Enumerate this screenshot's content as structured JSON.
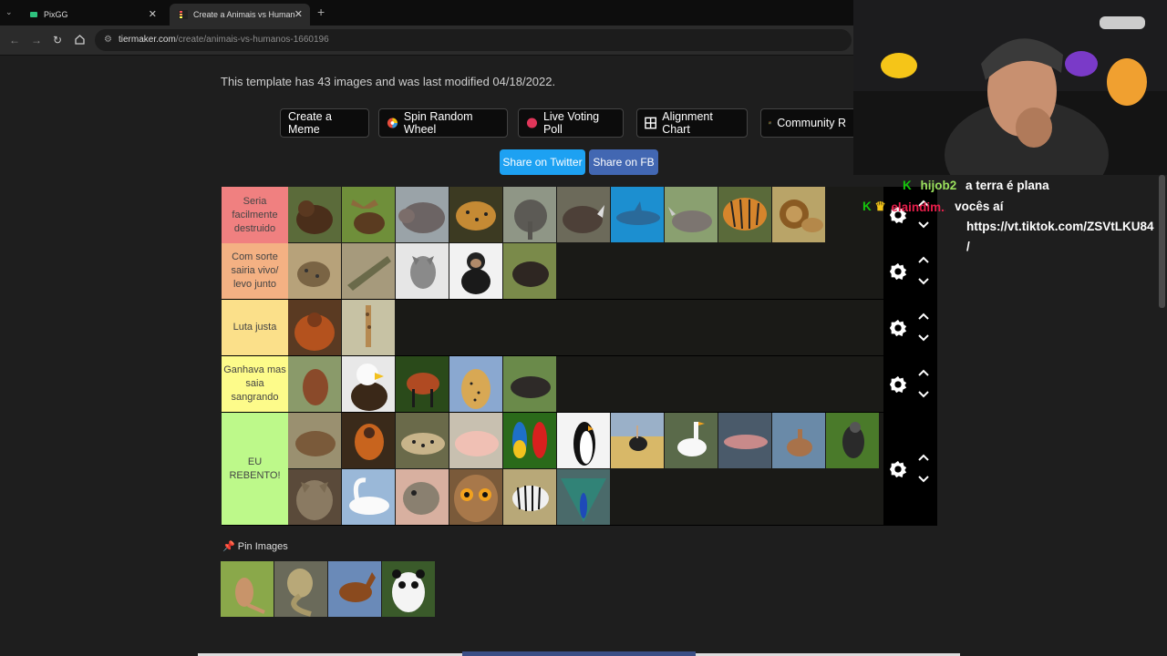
{
  "browser": {
    "tabs": [
      {
        "label": "PixGG"
      },
      {
        "label": "Create a Animais vs Humanos T"
      }
    ],
    "url_host": "tiermaker.com",
    "url_path": "/create/animais-vs-humanos-1660196"
  },
  "page": {
    "info_text": "This template has 43 images and was last modified 04/18/2022.",
    "buttons": {
      "create_meme": "Create a Meme",
      "spin_wheel": "Spin Random Wheel",
      "live_poll": "Live Voting Poll",
      "alignment": "Alignment Chart",
      "community": "Community R"
    },
    "share": {
      "twitter": "Share on Twitter",
      "fb": "Share on FB"
    },
    "tiers": [
      {
        "label": "Seria facilmente destruido",
        "color": "#f08080",
        "items": [
          "bear",
          "moose",
          "hippo",
          "jaguar",
          "elephant",
          "rhino",
          "shark",
          "rhino2",
          "tiger",
          "lion"
        ]
      },
      {
        "label": "Com sorte sairia vivo/ levo junto",
        "color": "#f4b183",
        "items": [
          "hyena",
          "crocodile",
          "wolf",
          "chimpanzee",
          "boar"
        ]
      },
      {
        "label": "Luta justa",
        "color": "#fbe08a",
        "items": [
          "orangutan",
          "giraffe"
        ]
      },
      {
        "label": "Ganhava mas saia sangrando",
        "color": "#fdfb8a",
        "items": [
          "dog",
          "eagle",
          "maned-wolf",
          "cheetah",
          "tapir"
        ]
      },
      {
        "label": "EU REBENTO!",
        "color": "#bdf98a",
        "items": [
          "capybara",
          "monkey",
          "ocelot",
          "pig",
          "macaws",
          "penguin",
          "ostrich",
          "goose",
          "dolphin",
          "deer",
          "hawk",
          "cat",
          "swan",
          "piranha",
          "owl",
          "zebra",
          "peacock"
        ]
      }
    ],
    "pin_label": "Pin Images",
    "pinned": [
      "kangaroo",
      "cobra",
      "horse",
      "panda"
    ]
  },
  "chat": {
    "messages": [
      {
        "user": "hijob2",
        "user_color": "#9be15d",
        "text": "a terra é plana"
      },
      {
        "user": "elaindim...",
        "user_color": "#e91e4b",
        "text": "vocês aí"
      },
      {
        "user": "",
        "user_color": "",
        "text": "https://vt.tiktok.com/ZSVtLKU84"
      },
      {
        "user": "",
        "user_color": "",
        "text": "/"
      }
    ]
  },
  "colors": {
    "twitter": "#1da1f2",
    "facebook": "#4267b2"
  }
}
